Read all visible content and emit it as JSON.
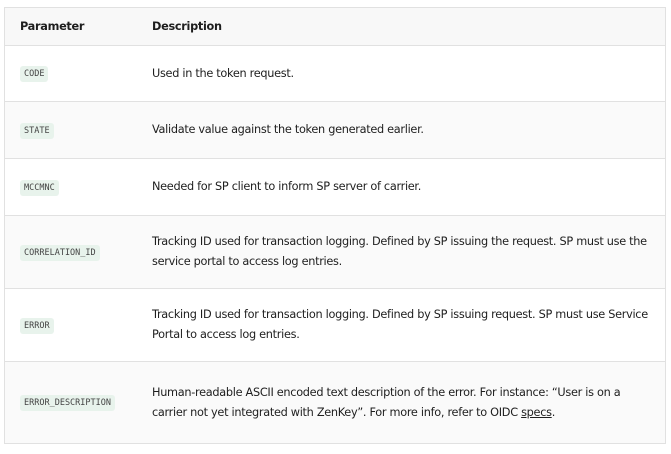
{
  "headers": {
    "parameter": "Parameter",
    "description": "Description"
  },
  "rows": [
    {
      "param": "CODE",
      "desc": "Used in the token request."
    },
    {
      "param": "STATE",
      "desc": "Validate value against the token generated earlier."
    },
    {
      "param": "MCCMNC",
      "desc": "Needed for SP client to inform SP server of carrier."
    },
    {
      "param": "CORRELATION_ID",
      "desc": "Tracking ID used for transaction logging. Defined by SP issuing the request. SP must use the service portal to access log entries."
    },
    {
      "param": "ERROR",
      "desc": "Tracking ID used for transaction logging. Defined by SP issuing request. SP must use Service Portal to access log entries."
    },
    {
      "param": "ERROR_DESCRIPTION",
      "desc": "Human-readable ASCII encoded text description of the error. For instance: “User is on a carrier not yet integrated with ZenKey”. For more info, refer to OIDC ",
      "link": "specs",
      "after": "."
    }
  ]
}
